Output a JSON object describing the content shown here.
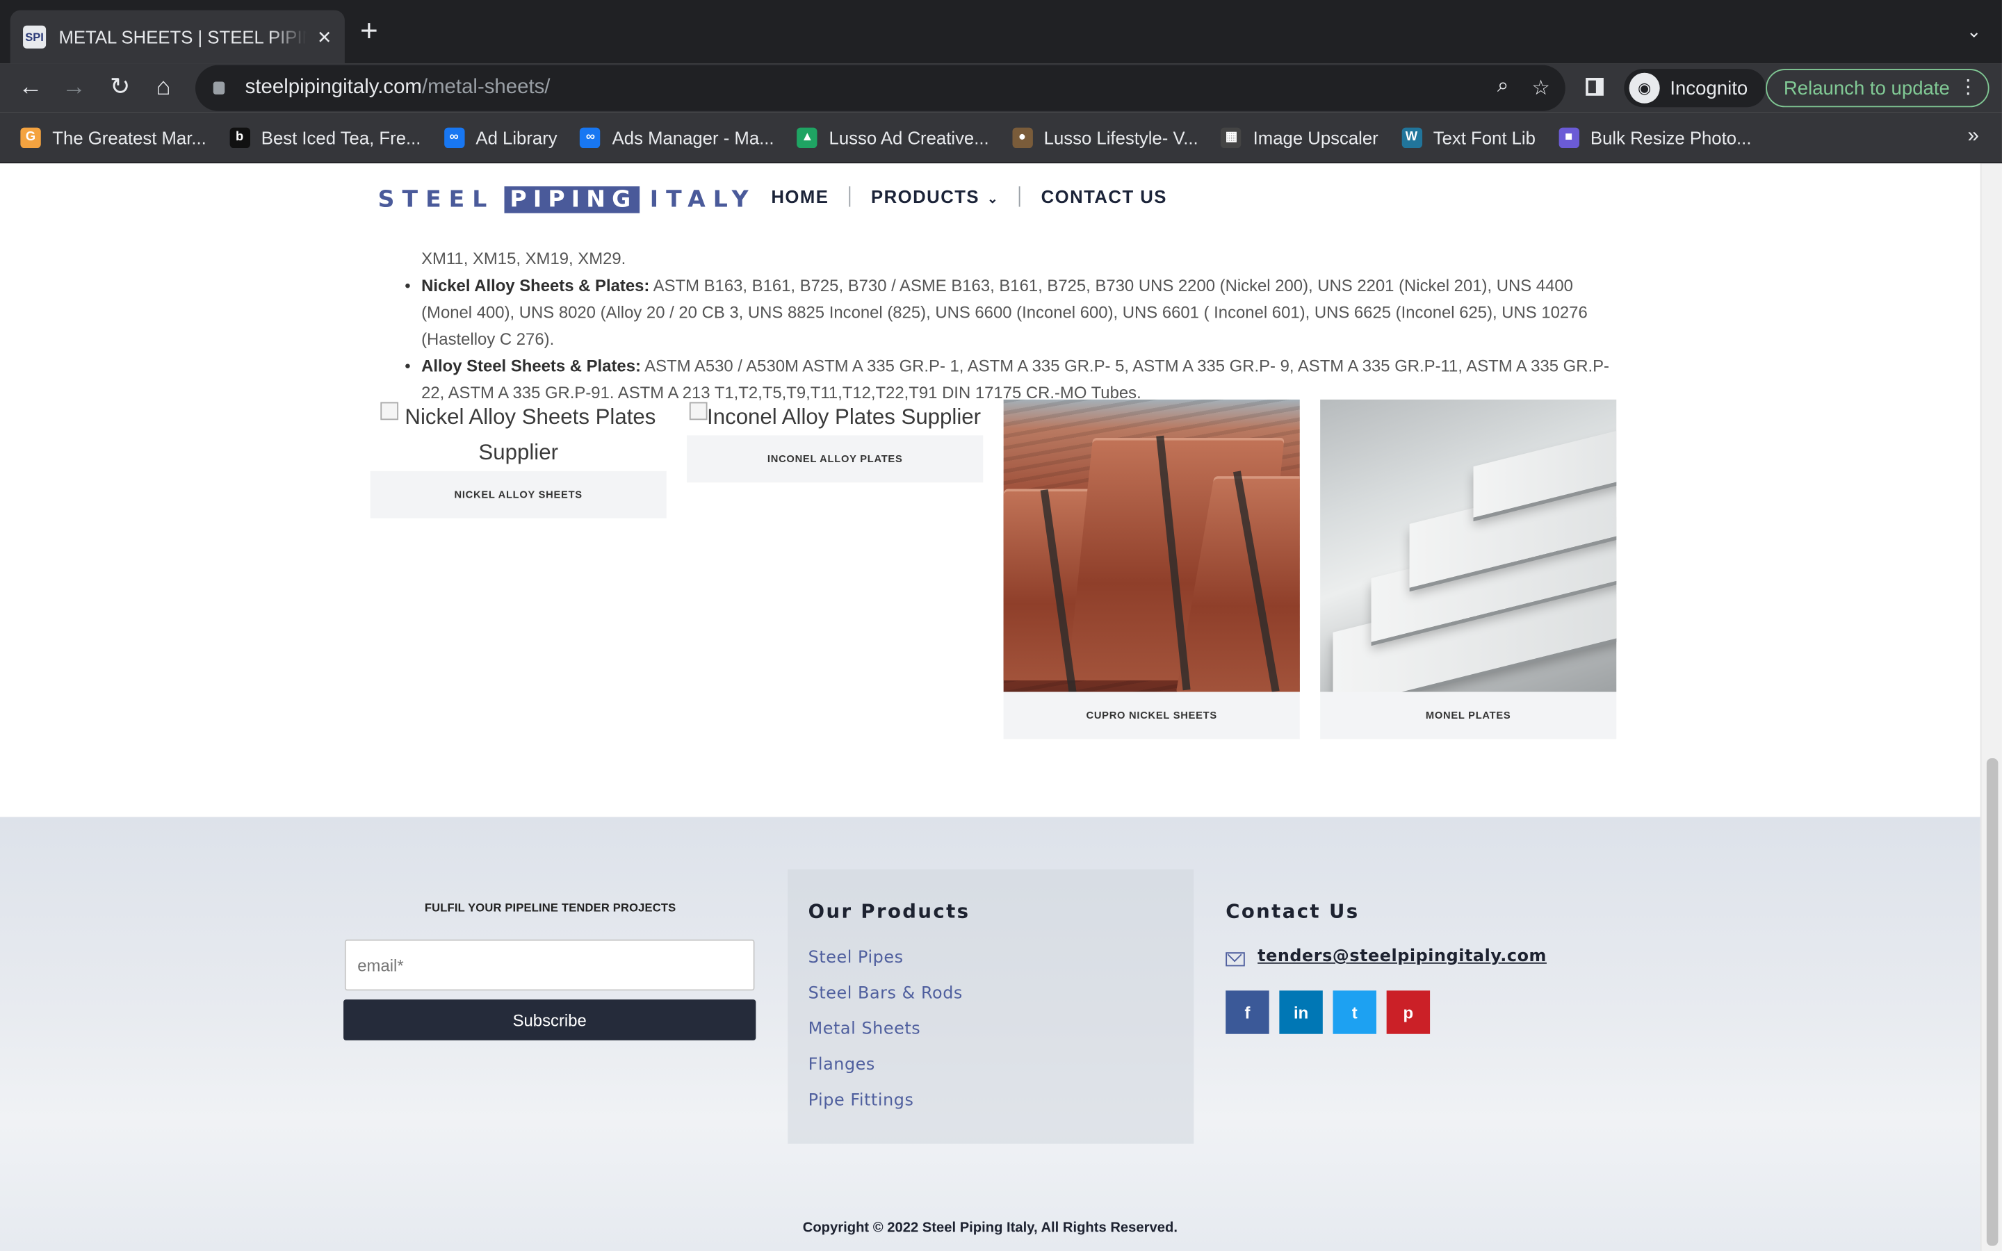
{
  "browser": {
    "tab_title": "METAL SHEETS | STEEL PIPING ITALY",
    "favicon_text": "SPI",
    "url_host": "steelpipingitaly.com",
    "url_path": "/metal-sheets/",
    "incognito_label": "Incognito",
    "relaunch_label": "Relaunch to update",
    "bookmarks": [
      {
        "label": "The Greatest Mar...",
        "color": "#f4a340",
        "icon": "G"
      },
      {
        "label": "Best Iced Tea, Fre...",
        "color": "#111111",
        "icon": "b"
      },
      {
        "label": "Ad Library",
        "color": "#1877f2",
        "icon": "∞"
      },
      {
        "label": "Ads Manager - Ma...",
        "color": "#1877f2",
        "icon": "∞"
      },
      {
        "label": "Lusso Ad Creative...",
        "color": "#1fa463",
        "icon": "▲"
      },
      {
        "label": "Lusso Lifestyle- V...",
        "color": "#7a5c3a",
        "icon": "●"
      },
      {
        "label": "Image Upscaler",
        "color": "#444444",
        "icon": "▦"
      },
      {
        "label": "Text Font Lib",
        "color": "#21759b",
        "icon": "W"
      },
      {
        "label": "Bulk Resize Photo...",
        "color": "#6b5bd6",
        "icon": "■"
      }
    ]
  },
  "site": {
    "logo": {
      "left": "STEEL",
      "middle": "PIPING",
      "right": "ITALY"
    },
    "nav": {
      "home": "HOME",
      "products": "PRODUCTS",
      "contact": "CONTACT US"
    },
    "specs": {
      "first_line": "XM11, XM15, XM19, XM29.",
      "nickel_label": "Nickel Alloy Sheets & Plates:",
      "nickel_text": " ASTM B163, B161, B725, B730 / ASME B163, B161, B725, B730 UNS 2200 (Nickel 200), UNS 2201 (Nickel 201), UNS 4400 (Monel 400), UNS 8020 (Alloy 20 / 20 CB 3, UNS 8825 Inconel (825), UNS 6600 (Inconel 600), UNS 6601 ( Inconel 601), UNS 6625 (Inconel 625), UNS 10276 (Hastelloy C 276).",
      "alloy_label": "Alloy Steel Sheets & Plates:",
      "alloy_text": " ASTM A530 / A530M ASTM A 335 GR.P- 1, ASTM A 335 GR.P- 5, ASTM A 335 GR.P- 9, ASTM A 335 GR.P-11, ASTM A 335 GR.P-22, ASTM A 335 GR.P-91. ASTM A 213 T1,T2,T5,T9,T11,T12,T22,T91 DIN 17175 CR.-MO Tubes."
    },
    "gallery": [
      {
        "alt": "Nickel Alloy Sheets Plates Supplier",
        "caption": "NICKEL ALLOY SHEETS"
      },
      {
        "alt": "Inconel Alloy Plates Supplier",
        "caption": "INCONEL ALLOY PLATES"
      },
      {
        "caption": "CUPRO NICKEL SHEETS"
      },
      {
        "caption": "MONEL PLATES"
      }
    ],
    "footer": {
      "tender_title": "FULFIL YOUR PIPELINE TENDER PROJECTS",
      "email_placeholder": "email*",
      "subscribe_label": "Subscribe",
      "products_heading": "Our Products",
      "products": [
        "Steel Pipes",
        "Steel Bars & Rods",
        "Metal Sheets",
        "Flanges",
        "Pipe Fittings"
      ],
      "contact_heading": "Contact Us",
      "email": "tenders@steelpipingitaly.com",
      "socials": [
        {
          "icon": "f",
          "color": "#3b5998"
        },
        {
          "icon": "in",
          "color": "#0077b5"
        },
        {
          "icon": "t",
          "color": "#1da1f2"
        },
        {
          "icon": "p",
          "color": "#cb2027"
        }
      ],
      "copyright": "Copyright © 2022 Steel Piping Italy, All Rights Reserved."
    }
  }
}
